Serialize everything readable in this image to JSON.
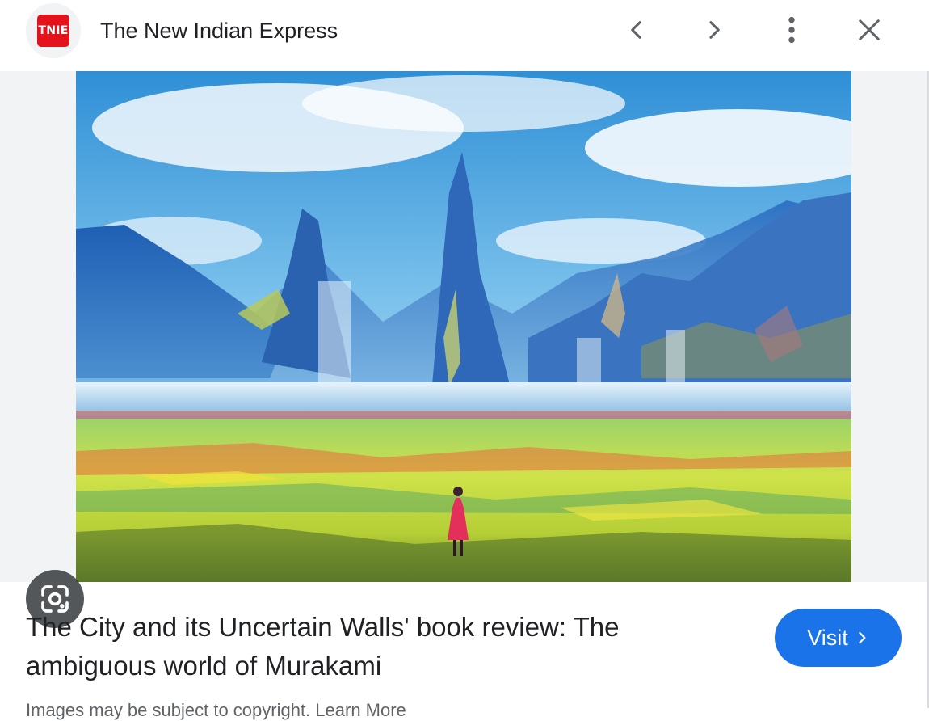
{
  "header": {
    "logo_text": "TNIE",
    "site_name": "The New Indian Express",
    "icons": {
      "back": "chevron-left-icon",
      "forward": "chevron-right-icon",
      "menu": "more-vert-icon",
      "close": "close-icon"
    }
  },
  "image": {
    "icon": "google-lens-icon"
  },
  "caption": {
    "title": "The City and its Uncertain Walls' book review: The ambiguous world of Murakami",
    "credit": "Images may be subject to copyright. Learn More"
  },
  "visit": {
    "label": "Visit"
  },
  "colors": {
    "brand": "#e3121b",
    "accent": "#1a73e8",
    "text": "#202124"
  }
}
